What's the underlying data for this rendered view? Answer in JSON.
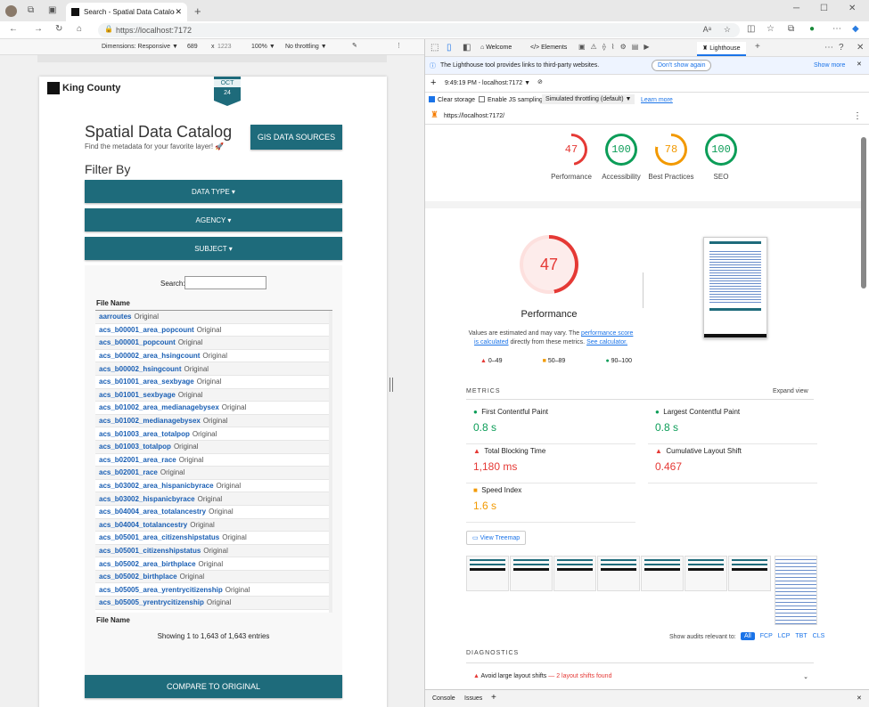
{
  "browser": {
    "tab_title": "Search - Spatial Data Catalog",
    "url": "https://localhost:7172"
  },
  "devtools_toolbar": {
    "dimensions_label": "Dimensions: Responsive",
    "width": "689",
    "x": "x",
    "height": "1223",
    "zoom": "100%",
    "throttling": "No throttling"
  },
  "page": {
    "logo": "King County",
    "date_month": "OCT",
    "date_day": "24",
    "title": "Spatial Data Catalog",
    "subtitle": "Find the metadata for your favorite layer! 🚀",
    "gis_button": "GIS DATA SOURCES",
    "filter_by": "Filter By",
    "filters": [
      "DATA TYPE ▾",
      "AGENCY ▾",
      "SUBJECT ▾"
    ],
    "search_label": "Search:",
    "col_header": "File Name",
    "rows": [
      {
        "name": "aarroutes",
        "tag": "Original"
      },
      {
        "name": "acs_b00001_area_popcount",
        "tag": "Original"
      },
      {
        "name": "acs_b00001_popcount",
        "tag": "Original"
      },
      {
        "name": "acs_b00002_area_hsingcount",
        "tag": "Original"
      },
      {
        "name": "acs_b00002_hsingcount",
        "tag": "Original"
      },
      {
        "name": "acs_b01001_area_sexbyage",
        "tag": "Original"
      },
      {
        "name": "acs_b01001_sexbyage",
        "tag": "Original"
      },
      {
        "name": "acs_b01002_area_medianagebysex",
        "tag": "Original"
      },
      {
        "name": "acs_b01002_medianagebysex",
        "tag": "Original"
      },
      {
        "name": "acs_b01003_area_totalpop",
        "tag": "Original"
      },
      {
        "name": "acs_b01003_totalpop",
        "tag": "Original"
      },
      {
        "name": "acs_b02001_area_race",
        "tag": "Original"
      },
      {
        "name": "acs_b02001_race",
        "tag": "Original"
      },
      {
        "name": "acs_b03002_area_hispanicbyrace",
        "tag": "Original"
      },
      {
        "name": "acs_b03002_hispanicbyrace",
        "tag": "Original"
      },
      {
        "name": "acs_b04004_area_totalancestry",
        "tag": "Original"
      },
      {
        "name": "acs_b04004_totalancestry",
        "tag": "Original"
      },
      {
        "name": "acs_b05001_area_citizenshipstatus",
        "tag": "Original"
      },
      {
        "name": "acs_b05001_citizenshipstatus",
        "tag": "Original"
      },
      {
        "name": "acs_b05002_area_birthplace",
        "tag": "Original"
      },
      {
        "name": "acs_b05002_birthplace",
        "tag": "Original"
      },
      {
        "name": "acs_b05005_area_yrentrycitizenship",
        "tag": "Original"
      },
      {
        "name": "acs_b05005_yrentrycitizenship",
        "tag": "Original"
      }
    ],
    "footer_header": "File Name",
    "showing": "Showing 1 to 1,643 of 1,643 entries",
    "compare_button": "COMPARE TO ORIGINAL"
  },
  "devtools": {
    "tabs": [
      "Welcome",
      "Elements",
      "Lighthouse"
    ],
    "info_text": "The Lighthouse tool provides links to third-party websites.",
    "dont_show": "Don't show again",
    "show_more": "Show more",
    "report_select": "9:49:19 PM - localhost:7172",
    "clear_storage": "Clear storage",
    "js_sampling": "Enable JS sampling",
    "throttle_select": "Simulated throttling (default)",
    "learn_more": "Learn more",
    "report_url": "https://localhost:7172/",
    "scores": [
      {
        "label": "Performance",
        "value": "47",
        "color": "#e53935"
      },
      {
        "label": "Accessibility",
        "value": "100",
        "color": "#0c9d58"
      },
      {
        "label": "Best Practices",
        "value": "78",
        "color": "#f29900"
      },
      {
        "label": "SEO",
        "value": "100",
        "color": "#0c9d58"
      }
    ],
    "big_score": "47",
    "big_label": "Performance",
    "note_prefix": "Values are estimated and may vary. The ",
    "note_link1": "performance score is calculated",
    "note_mid": " directly from these metrics. ",
    "note_link2": "See calculator.",
    "legend": [
      "0–49",
      "50–89",
      "90–100"
    ],
    "metrics_title": "METRICS",
    "expand_view": "Expand view",
    "metrics": [
      {
        "name": "First Contentful Paint",
        "value": "0.8 s",
        "status": "good"
      },
      {
        "name": "Largest Contentful Paint",
        "value": "0.8 s",
        "status": "good"
      },
      {
        "name": "Total Blocking Time",
        "value": "1,180 ms",
        "status": "bad"
      },
      {
        "name": "Cumulative Layout Shift",
        "value": "0.467",
        "status": "bad"
      },
      {
        "name": "Speed Index",
        "value": "1.6 s",
        "status": "average"
      }
    ],
    "treemap": "View Treemap",
    "show_audits": "Show audits relevant to:",
    "audit_filters": [
      "All",
      "FCP",
      "LCP",
      "TBT",
      "CLS"
    ],
    "diagnostics": "DIAGNOSTICS",
    "diag_item": "Avoid large layout shifts",
    "diag_detail": "— 2 layout shifts found",
    "drawer_tabs": [
      "Console",
      "Issues"
    ]
  }
}
